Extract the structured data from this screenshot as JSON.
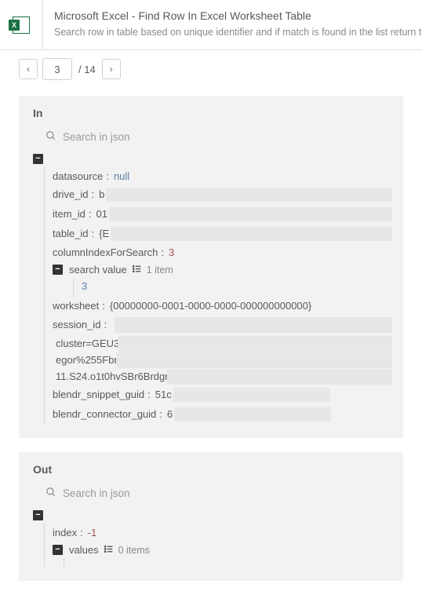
{
  "header": {
    "title": "Microsoft Excel - Find Row In Excel Worksheet Table",
    "description": "Search row in table based on unique identifier and if match is found in the list return the row index. If not"
  },
  "pager": {
    "prev_glyph": "‹",
    "current": "3",
    "total_label": "/ 14",
    "next_glyph": "›"
  },
  "in_panel": {
    "title": "In",
    "search_placeholder": "Search in json",
    "fields": {
      "datasource": {
        "key": "datasource",
        "value": "null"
      },
      "drive_id": {
        "key": "drive_id",
        "value": "b"
      },
      "item_id": {
        "key": "item_id",
        "value": "01"
      },
      "table_id": {
        "key": "table_id",
        "value": "{E"
      },
      "columnIndexForSearch": {
        "key": "columnIndexForSearch",
        "value": "3"
      },
      "search_value": {
        "key": "search value",
        "count_label": "1 item",
        "item": "3"
      },
      "worksheet": {
        "key": "worksheet",
        "value": "{00000000-0001-0000-0000-000000000000}"
      },
      "session_id": {
        "key": "session_id",
        "line1": "cluster=GEU3",
        "line2": "egor%255Fbr",
        "line3": "11.S24.o1t0hvSBr6Brdgr"
      },
      "blendr_snippet_guid": {
        "key": "blendr_snippet_guid",
        "value": "51c"
      },
      "blendr_connector_guid": {
        "key": "blendr_connector_guid",
        "value": "6"
      }
    }
  },
  "out_panel": {
    "title": "Out",
    "search_placeholder": "Search in json",
    "fields": {
      "index": {
        "key": "index",
        "value": "-1"
      },
      "values": {
        "key": "values",
        "count_label": "0 items"
      }
    }
  }
}
